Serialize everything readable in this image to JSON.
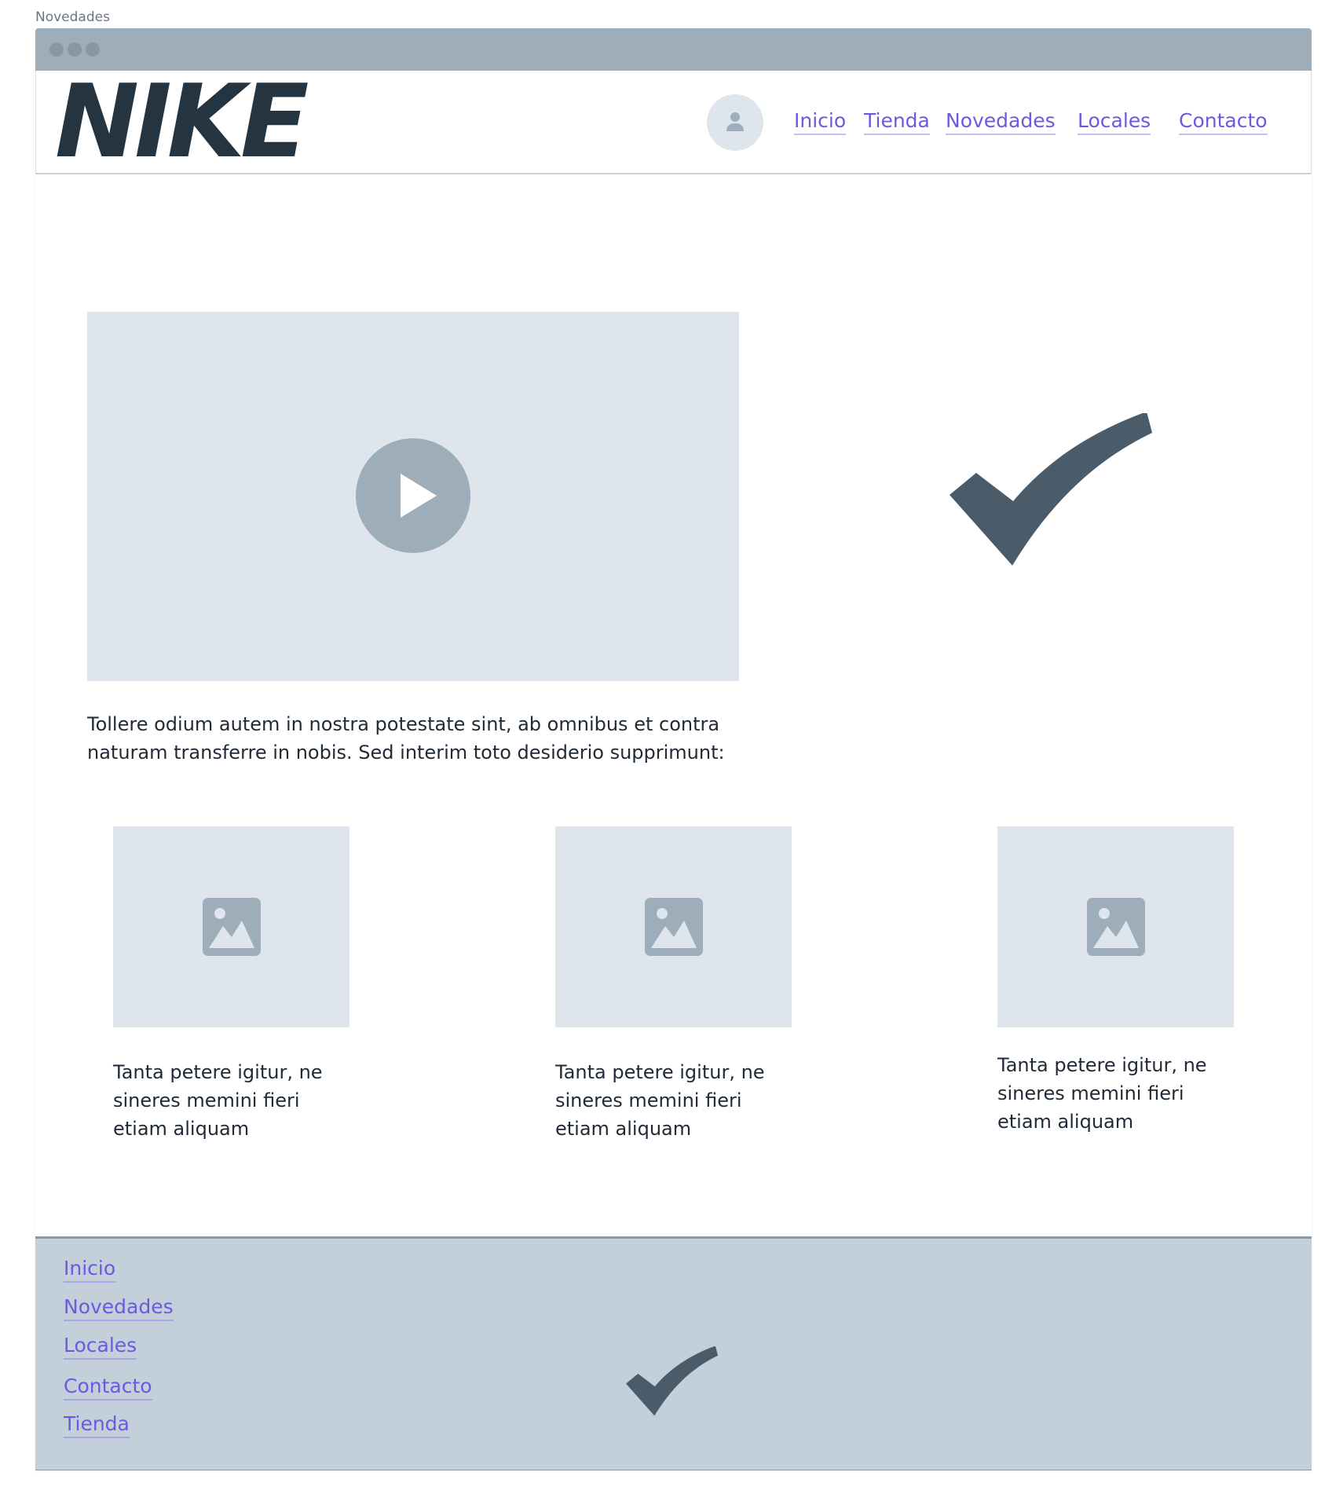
{
  "frame": {
    "label": "Novedades"
  },
  "header": {
    "logo": "NIKE",
    "nav": [
      {
        "label": "Inicio"
      },
      {
        "label": "Tienda"
      },
      {
        "label": "Novedades"
      },
      {
        "label": "Locales"
      },
      {
        "label": "Contacto"
      }
    ]
  },
  "main": {
    "intro": "Tollere odium autem in nostra potestate sint, ab omnibus et contra naturam transferre in nobis. Sed interim toto desiderio supprimunt:",
    "cards": [
      {
        "text": "Tanta petere igitur, ne sineres memini fieri etiam aliquam"
      },
      {
        "text": "Tanta petere igitur, ne sineres memini fieri etiam aliquam"
      },
      {
        "text": "Tanta petere igitur, ne sineres memini fieri etiam aliquam"
      }
    ]
  },
  "footer": {
    "links": [
      {
        "label": "Inicio"
      },
      {
        "label": "Novedades"
      },
      {
        "label": "Locales"
      },
      {
        "label": "Contacto"
      },
      {
        "label": "Tienda"
      }
    ]
  },
  "colors": {
    "link": "#6a5ae0",
    "placeholder_bg": "#dfe5ec",
    "placeholder_icon": "#9dadb9",
    "logo": "#243441",
    "swoosh": "#4a5b6a",
    "footer_bg": "#c3cfd9",
    "titlebar": "#9dadb9"
  },
  "icons": {
    "avatar": "user-icon",
    "video": "play-icon",
    "card_image": "image-icon",
    "brand_mark": "swoosh-icon"
  }
}
